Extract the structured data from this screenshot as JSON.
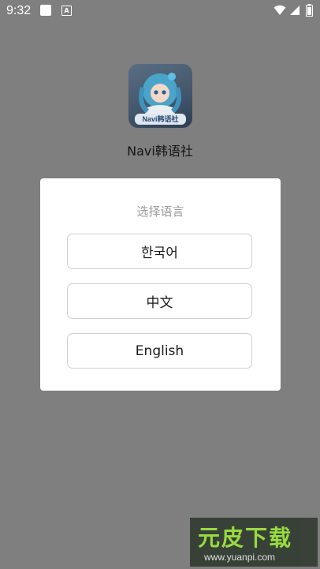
{
  "status_bar": {
    "time": "9:32",
    "notification_icons": [
      "square-icon",
      "a-icon"
    ],
    "right_icons": [
      "wifi-icon",
      "signal-icon",
      "battery-icon"
    ],
    "a_glyph": "A"
  },
  "app": {
    "name": "Navi韩语社",
    "icon_banner": "Navi韩语社"
  },
  "dialog": {
    "title": "选择语言",
    "options": [
      {
        "label": "한국어"
      },
      {
        "label": "中文"
      },
      {
        "label": "English"
      }
    ]
  },
  "watermark": {
    "text": "元皮下载",
    "url": "www.yuanpi.com"
  },
  "colors": {
    "scrim": "#7f7f7f",
    "dialog_bg": "#ffffff",
    "button_border": "#d0d0d0",
    "title_text": "#9a9a9a"
  }
}
